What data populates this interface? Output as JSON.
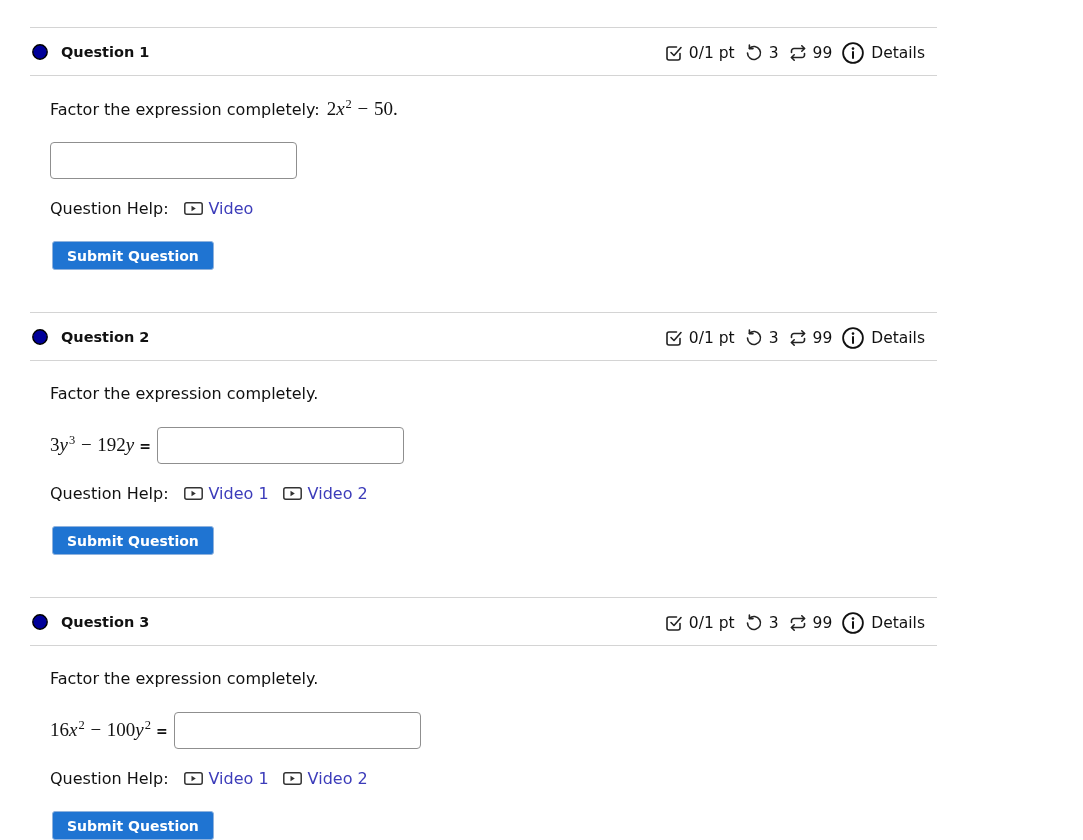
{
  "questions": [
    {
      "title": "Question 1",
      "score": "0/1 pt",
      "retries": "3",
      "attempts": "99",
      "details": "Details",
      "prompt": "Factor the expression completely:",
      "math": [
        {
          "kind": "number",
          "text": "2"
        },
        {
          "kind": "variable",
          "text": "x",
          "power": "2"
        },
        {
          "kind": "operator",
          "text": "−"
        },
        {
          "kind": "number",
          "text": "50."
        }
      ],
      "help_label": "Question Help:",
      "help_links": [
        "Video"
      ],
      "submit": "Submit Question"
    },
    {
      "title": "Question 2",
      "score": "0/1 pt",
      "retries": "3",
      "attempts": "99",
      "details": "Details",
      "prompt": "Factor the expression completely.",
      "equation": [
        {
          "kind": "number",
          "text": "3"
        },
        {
          "kind": "variable",
          "text": "y",
          "power": "3"
        },
        {
          "kind": "operator",
          "text": "−"
        },
        {
          "kind": "number",
          "text": "192"
        },
        {
          "kind": "variable",
          "text": "y"
        }
      ],
      "equals": "=",
      "help_label": "Question Help:",
      "help_links": [
        "Video 1",
        "Video 2"
      ],
      "submit": "Submit Question"
    },
    {
      "title": "Question 3",
      "score": "0/1 pt",
      "retries": "3",
      "attempts": "99",
      "details": "Details",
      "prompt": "Factor the expression completely.",
      "equation": [
        {
          "kind": "number",
          "text": "16"
        },
        {
          "kind": "variable",
          "text": "x",
          "power": "2"
        },
        {
          "kind": "operator",
          "text": "−"
        },
        {
          "kind": "number",
          "text": "100"
        },
        {
          "kind": "variable",
          "text": "y",
          "power": "2"
        }
      ],
      "equals": "=",
      "help_label": "Question Help:",
      "help_links": [
        "Video 1",
        "Video 2"
      ],
      "submit": "Submit Question"
    }
  ]
}
